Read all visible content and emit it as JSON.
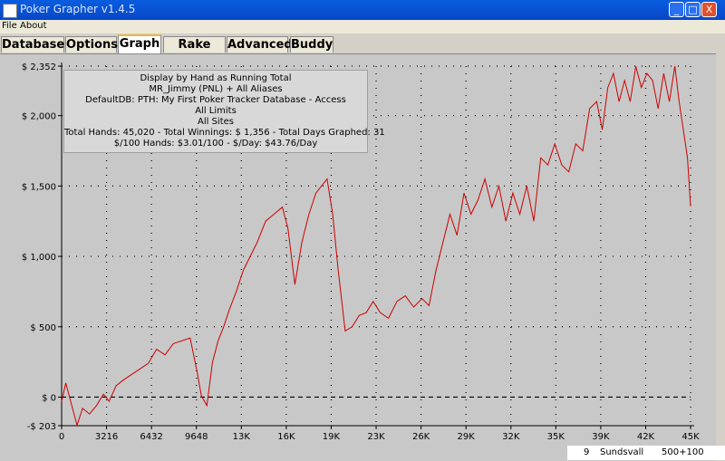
{
  "window": {
    "title": "Poker Grapher v1.4.5",
    "buttons": [
      "_",
      "□",
      "X"
    ]
  },
  "menu": [
    "File",
    "About"
  ],
  "tabs": [
    {
      "label": "Databases",
      "active": false
    },
    {
      "label": "Options",
      "active": false
    },
    {
      "label": "Graph",
      "active": true
    },
    {
      "label": "Rake Calc",
      "active": false
    },
    {
      "label": "Advanced",
      "active": false
    },
    {
      "label": "Buddy",
      "active": false
    }
  ],
  "info": {
    "lines": [
      "Display by Hand as Running Total",
      "MR_Jimmy (PNL) + All Aliases",
      "DefaultDB: PTH: My First Poker Tracker Database - Access",
      "All Limits",
      "All Sites",
      "Total Hands: 45,020 - Total Winnings: $ 1,356 - Total Days Graphed: 31",
      "$/100 Hands: $3.01/100 - $/Day: $43.76/Day"
    ]
  },
  "bottom_strip": {
    "row": "9",
    "name": "Sundsvall",
    "value": "500+100"
  },
  "colors": {
    "line": "#cc0000",
    "titlebar": "#0747c6",
    "plot_bg": "#c8c8c8"
  },
  "chart_data": {
    "type": "line",
    "xlim": [
      0,
      45020
    ],
    "ylim": [
      -203,
      2352
    ],
    "x_ticks": [
      {
        "v": 0,
        "label": "0"
      },
      {
        "v": 3216,
        "label": "3216"
      },
      {
        "v": 6432,
        "label": "6432"
      },
      {
        "v": 9648,
        "label": "9648"
      },
      {
        "v": 12864,
        "label": "13K"
      },
      {
        "v": 16080,
        "label": "16K"
      },
      {
        "v": 19296,
        "label": "19K"
      },
      {
        "v": 22512,
        "label": "23K"
      },
      {
        "v": 25728,
        "label": "26K"
      },
      {
        "v": 28944,
        "label": "29K"
      },
      {
        "v": 32160,
        "label": "32K"
      },
      {
        "v": 35376,
        "label": "35K"
      },
      {
        "v": 38592,
        "label": "39K"
      },
      {
        "v": 41808,
        "label": "42K"
      },
      {
        "v": 45020,
        "label": "45K"
      }
    ],
    "y_ticks": [
      {
        "v": -203,
        "label": "-$ 203"
      },
      {
        "v": 0,
        "label": "$ 0"
      },
      {
        "v": 500,
        "label": "$ 500"
      },
      {
        "v": 1000,
        "label": "$ 1,000"
      },
      {
        "v": 1500,
        "label": "$ 1,500"
      },
      {
        "v": 2000,
        "label": "$ 2,000"
      },
      {
        "v": 2352,
        "label": "$ 2,352"
      }
    ],
    "grid": true,
    "zero_line": true,
    "series": [
      {
        "x": [
          0,
          300,
          700,
          1100,
          1500,
          2000,
          2500,
          3000,
          3400,
          3900,
          4400,
          5000,
          5600,
          6200,
          6800,
          7400,
          8000,
          8600,
          9200,
          9700,
          10000,
          10400,
          10800,
          11200,
          11600,
          12000,
          12500,
          13000,
          13500,
          14000,
          14600,
          15200,
          15800,
          16200,
          16700,
          17200,
          17700,
          18200,
          18600,
          19000,
          19400,
          19800,
          20300,
          20800,
          21300,
          21800,
          22300,
          22800,
          23400,
          24000,
          24600,
          25200,
          25800,
          26300,
          26800,
          27300,
          27800,
          28300,
          28800,
          29300,
          29800,
          30300,
          30800,
          31300,
          31800,
          32300,
          32800,
          33300,
          33800,
          34300,
          34800,
          35300,
          35800,
          36300,
          36800,
          37300,
          37800,
          38300,
          38700,
          39100,
          39500,
          39900,
          40300,
          40700,
          41100,
          41500,
          41900,
          42300,
          42700,
          43100,
          43500,
          43900,
          44200,
          44500,
          44800,
          45020
        ],
        "y": [
          -30,
          100,
          -50,
          -200,
          -80,
          -120,
          -60,
          20,
          -30,
          80,
          120,
          160,
          200,
          240,
          340,
          300,
          380,
          400,
          420,
          180,
          10,
          -60,
          250,
          400,
          500,
          620,
          750,
          900,
          1000,
          1100,
          1250,
          1300,
          1350,
          1200,
          800,
          1100,
          1300,
          1450,
          1500,
          1550,
          1300,
          900,
          470,
          500,
          580,
          600,
          680,
          600,
          560,
          680,
          720,
          640,
          700,
          650,
          900,
          1100,
          1300,
          1150,
          1450,
          1300,
          1400,
          1550,
          1350,
          1500,
          1250,
          1450,
          1300,
          1500,
          1250,
          1700,
          1650,
          1800,
          1650,
          1600,
          1800,
          1750,
          2050,
          2100,
          1900,
          2200,
          2300,
          2100,
          2250,
          2100,
          2350,
          2200,
          2300,
          2250,
          2050,
          2300,
          2100,
          2352,
          2100,
          1900,
          1700,
          1356
        ],
        "color": "#cc0000"
      }
    ]
  }
}
